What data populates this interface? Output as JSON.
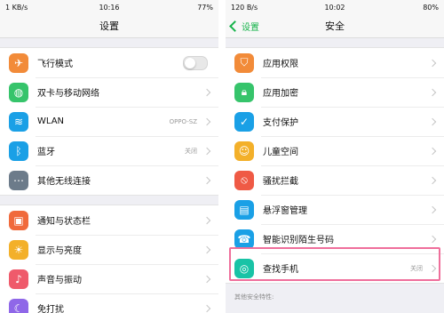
{
  "left": {
    "status": {
      "left": "1 KB/s",
      "time": "10:16",
      "battery": "77%"
    },
    "title": "设置",
    "groups": [
      [
        {
          "label": "飞行模式",
          "icon": "airplane-icon",
          "color": "#f28b39",
          "control": "toggle"
        },
        {
          "label": "双卡与移动网络",
          "icon": "cellular-globe-icon",
          "color": "#36c46b"
        },
        {
          "label": "WLAN",
          "icon": "wifi-icon",
          "color": "#1aa0e6",
          "value": "OPPO-SZ"
        },
        {
          "label": "蓝牙",
          "icon": "bluetooth-icon",
          "color": "#1aa0e6",
          "value": "关闭"
        },
        {
          "label": "其他无线连接",
          "icon": "more-dots-icon",
          "color": "#6c7b8a"
        }
      ],
      [
        {
          "label": "通知与状态栏",
          "icon": "notification-icon",
          "color": "#f06a3c"
        },
        {
          "label": "显示与亮度",
          "icon": "brightness-icon",
          "color": "#f3b02a"
        },
        {
          "label": "声音与振动",
          "icon": "speaker-icon",
          "color": "#ef5a6b"
        },
        {
          "label": "免打扰",
          "icon": "moon-icon",
          "color": "#8f67e8"
        }
      ]
    ]
  },
  "right": {
    "status": {
      "left": "120 B/s",
      "time": "10:02",
      "battery": "80%"
    },
    "title": "安全",
    "back_label": "设置",
    "rows": [
      {
        "label": "应用权限",
        "icon": "shield-key-icon",
        "color": "#f28b39"
      },
      {
        "label": "应用加密",
        "icon": "lock-icon",
        "color": "#36c46b"
      },
      {
        "label": "支付保护",
        "icon": "shield-check-icon",
        "color": "#1aa0e6"
      },
      {
        "label": "儿童空间",
        "icon": "child-icon",
        "color": "#f3b02a"
      },
      {
        "label": "骚扰拦截",
        "icon": "block-icon",
        "color": "#ef5a45"
      },
      {
        "label": "悬浮窗管理",
        "icon": "floating-window-icon",
        "color": "#1aa0e6"
      },
      {
        "label": "智能识别陌生号码",
        "icon": "contact-card-icon",
        "color": "#1aa0e6"
      },
      {
        "label": "查找手机",
        "icon": "radar-icon",
        "color": "#19c3a6",
        "value": "关闭",
        "highlight": true
      }
    ],
    "footnote": "其他安全特性:"
  }
}
